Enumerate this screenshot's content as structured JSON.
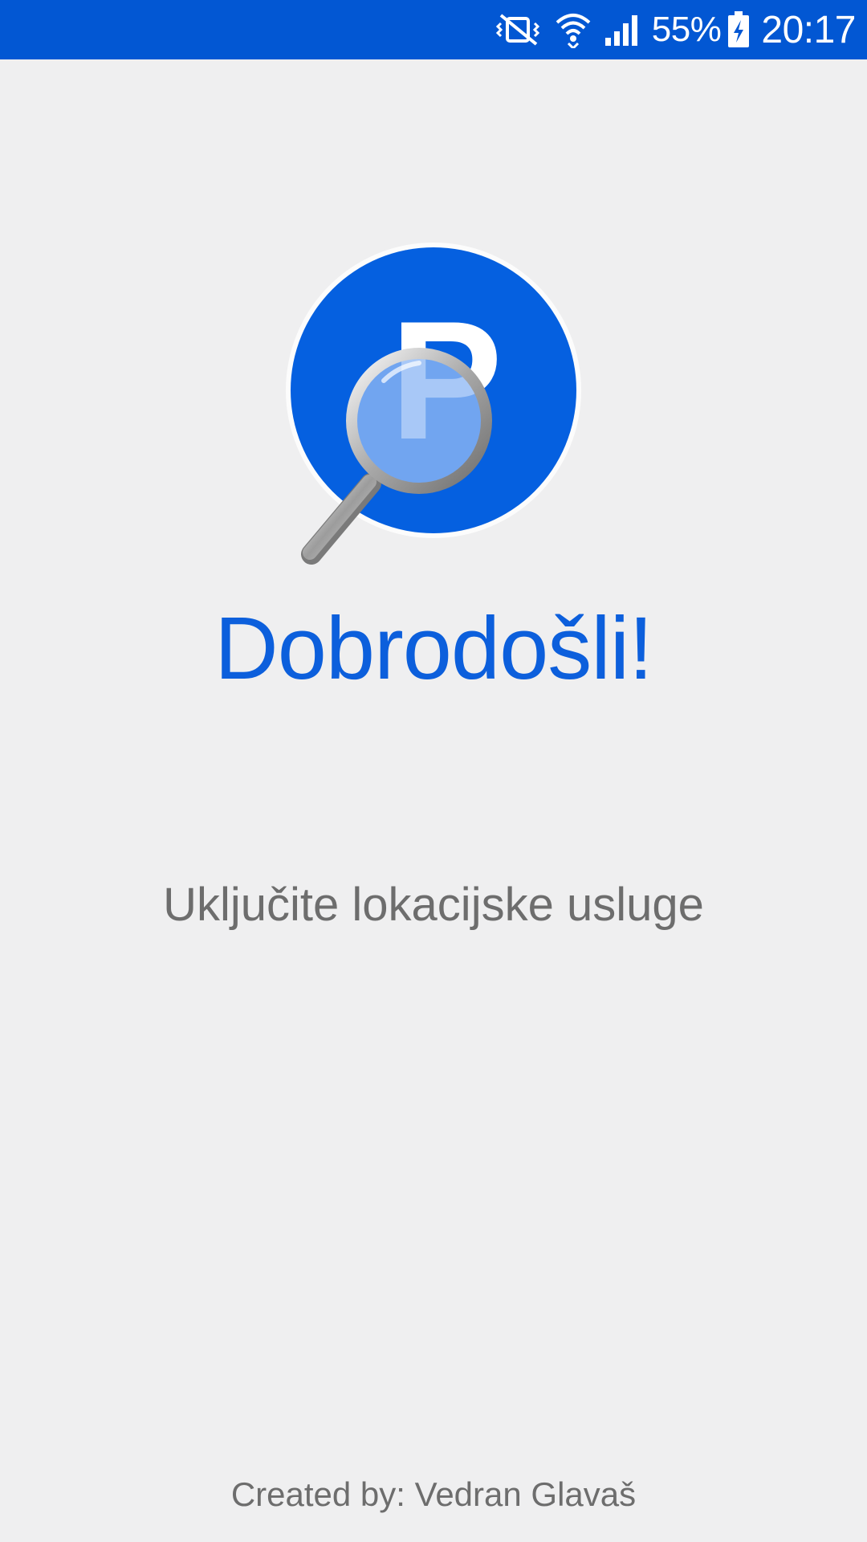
{
  "status_bar": {
    "battery_percent": "55%",
    "time": "20:17",
    "icons": [
      "mute-vibrate-icon",
      "wifi-icon",
      "cell-signal-icon",
      "battery-charging-icon"
    ],
    "background_color": "#0257d3"
  },
  "logo": {
    "letter": "P",
    "circle_color": "#0560e0",
    "icon": "parking-search-logo"
  },
  "welcome": {
    "title": "Dobrodošli!",
    "title_color": "#0c5fdc"
  },
  "message": {
    "text": "Uključite lokacijske usluge"
  },
  "footer": {
    "credit": "Created by: Vedran Glavaš"
  },
  "colors": {
    "background": "#efeff0",
    "text_gray": "#6d6d6d"
  }
}
